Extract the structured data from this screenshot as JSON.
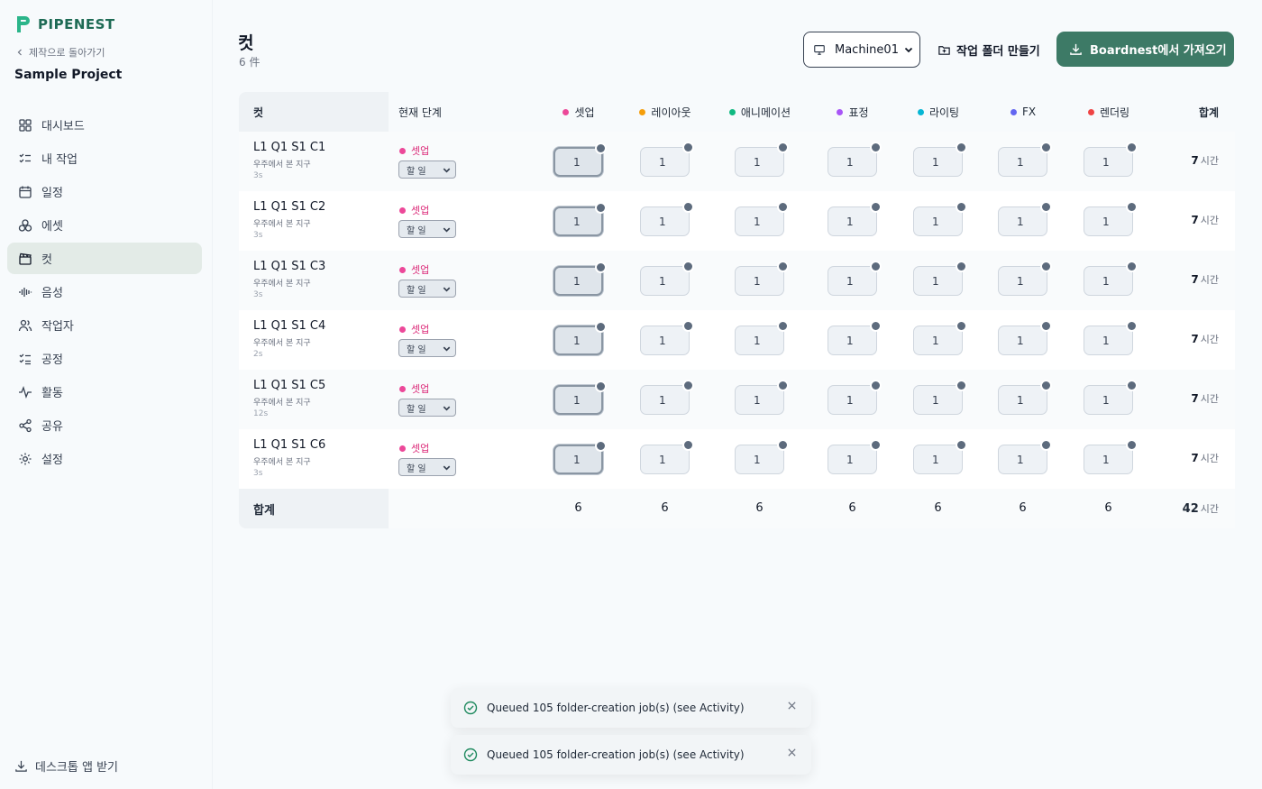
{
  "app": {
    "name": "PIPENEST",
    "brand_color": "#1e6b55",
    "accent_color": "#3d7a66"
  },
  "sidebar": {
    "back_label": "제작으로 돌아가기",
    "project": "Sample Project",
    "items": [
      {
        "label": "대시보드",
        "icon": "dashboard-icon"
      },
      {
        "label": "내 작업",
        "icon": "tasks-icon"
      },
      {
        "label": "일정",
        "icon": "calendar-icon"
      },
      {
        "label": "에셋",
        "icon": "assets-icon"
      },
      {
        "label": "컷",
        "icon": "clapper-icon",
        "active": true
      },
      {
        "label": "음성",
        "icon": "audio-wave-icon"
      },
      {
        "label": "작업자",
        "icon": "people-icon"
      },
      {
        "label": "공정",
        "icon": "process-list-icon"
      },
      {
        "label": "활동",
        "icon": "activity-icon"
      },
      {
        "label": "공유",
        "icon": "share-icon"
      },
      {
        "label": "설정",
        "icon": "gear-icon"
      }
    ],
    "desktop_label": "데스크톱 앱 받기"
  },
  "header": {
    "title": "컷",
    "count": "6 件",
    "machine": "Machine01",
    "folder_label": "작업 폴더 만들기",
    "import_label": "Boardnest에서 가져오기"
  },
  "table": {
    "headers": {
      "shot": "컷",
      "stage": "현재 단계",
      "total": "합계"
    },
    "departments": [
      {
        "label": "셋업",
        "color": "#ec4899"
      },
      {
        "label": "레이아웃",
        "color": "#f59e0b"
      },
      {
        "label": "애니메이션",
        "color": "#10b981"
      },
      {
        "label": "표정",
        "color": "#a855f7"
      },
      {
        "label": "라이팅",
        "color": "#06b6d4"
      },
      {
        "label": "FX",
        "color": "#6366f1"
      },
      {
        "label": "렌더링",
        "color": "#ef4444"
      }
    ],
    "rows": [
      {
        "name": "L1 Q1 S1 C1",
        "desc": "우주에서 본 지구",
        "duration": "3s",
        "stage": "셋업",
        "status": "할 일",
        "values": [
          "1",
          "1",
          "1",
          "1",
          "1",
          "1",
          "1"
        ],
        "total": "7",
        "unit": "시간"
      },
      {
        "name": "L1 Q1 S1 C2",
        "desc": "우주에서 본 지구",
        "duration": "3s",
        "stage": "셋업",
        "status": "할 일",
        "values": [
          "1",
          "1",
          "1",
          "1",
          "1",
          "1",
          "1"
        ],
        "total": "7",
        "unit": "시간"
      },
      {
        "name": "L1 Q1 S1 C3",
        "desc": "우주에서 본 지구",
        "duration": "3s",
        "stage": "셋업",
        "status": "할 일",
        "values": [
          "1",
          "1",
          "1",
          "1",
          "1",
          "1",
          "1"
        ],
        "total": "7",
        "unit": "시간"
      },
      {
        "name": "L1 Q1 S1 C4",
        "desc": "우주에서 본 지구",
        "duration": "2s",
        "stage": "셋업",
        "status": "할 일",
        "values": [
          "1",
          "1",
          "1",
          "1",
          "1",
          "1",
          "1"
        ],
        "total": "7",
        "unit": "시간"
      },
      {
        "name": "L1 Q1 S1 C5",
        "desc": "우주에서 본 지구",
        "duration": "12s",
        "stage": "셋업",
        "status": "할 일",
        "values": [
          "1",
          "1",
          "1",
          "1",
          "1",
          "1",
          "1"
        ],
        "total": "7",
        "unit": "시간"
      },
      {
        "name": "L1 Q1 S1 C6",
        "desc": "우주에서 본 지구",
        "duration": "3s",
        "stage": "셋업",
        "status": "할 일",
        "values": [
          "1",
          "1",
          "1",
          "1",
          "1",
          "1",
          "1"
        ],
        "total": "7",
        "unit": "시간"
      }
    ],
    "footer": {
      "label": "합계",
      "values": [
        "6",
        "6",
        "6",
        "6",
        "6",
        "6",
        "6"
      ],
      "total": "42",
      "unit": "시간"
    }
  },
  "toasts": [
    {
      "message": "Queued 105 folder-creation job(s) (see Activity)"
    },
    {
      "message": "Queued 105 folder-creation job(s) (see Activity)"
    }
  ]
}
